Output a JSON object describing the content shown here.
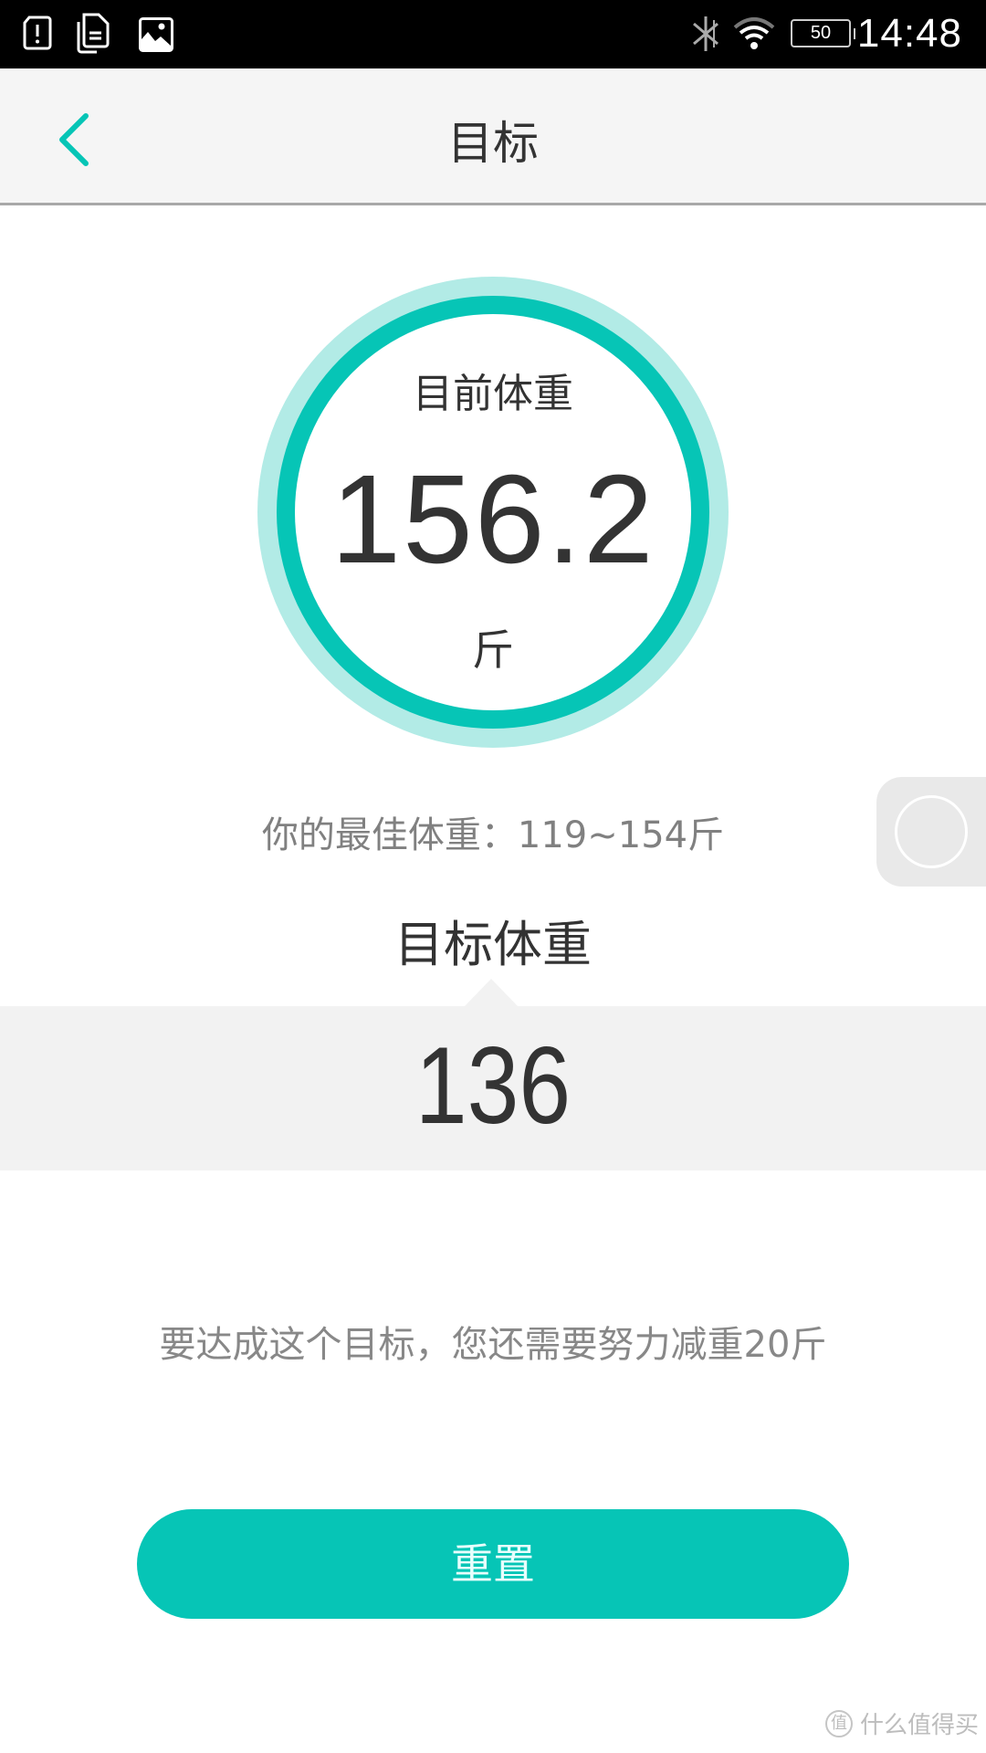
{
  "status_bar": {
    "icons_left": [
      "sim-alert-icon",
      "documents-icon",
      "image-icon"
    ],
    "icons_right": [
      "bluetooth-off-icon",
      "wifi-icon"
    ],
    "battery_level": "50",
    "time": "14:48"
  },
  "header": {
    "back_icon": "chevron-left-icon",
    "title": "目标"
  },
  "current_weight": {
    "label": "目前体重",
    "value": "156.2",
    "unit": "斤"
  },
  "best_weight": {
    "text": "你的最佳体重：119~154斤"
  },
  "target": {
    "title": "目标体重",
    "value": "136"
  },
  "hint": "要达成这个目标，您还需要努力减重20斤",
  "reset_button": "重置",
  "floating_button": {
    "icon": "assistive-touch-icon"
  },
  "watermark": {
    "logo": "值",
    "text": "什么值得买"
  },
  "colors": {
    "accent": "#06c5b6",
    "accent_light": "#b2ebe6",
    "picker_bg": "#f2f2f2",
    "header_bg": "#f5f5f5"
  }
}
